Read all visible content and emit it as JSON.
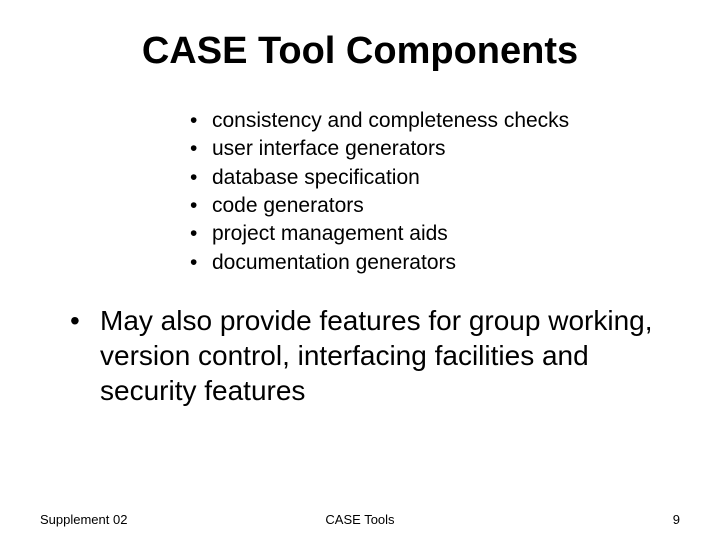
{
  "title": "CASE Tool Components",
  "sub_bullets": [
    "consistency and completeness checks",
    "user interface generators",
    "database specification",
    "code generators",
    "project management aids",
    "documentation generators"
  ],
  "main_bullet": "May also provide features for group working, version control, interfacing facilities and security features",
  "footer": {
    "left": "Supplement 02",
    "center": "CASE Tools",
    "right": "9"
  }
}
